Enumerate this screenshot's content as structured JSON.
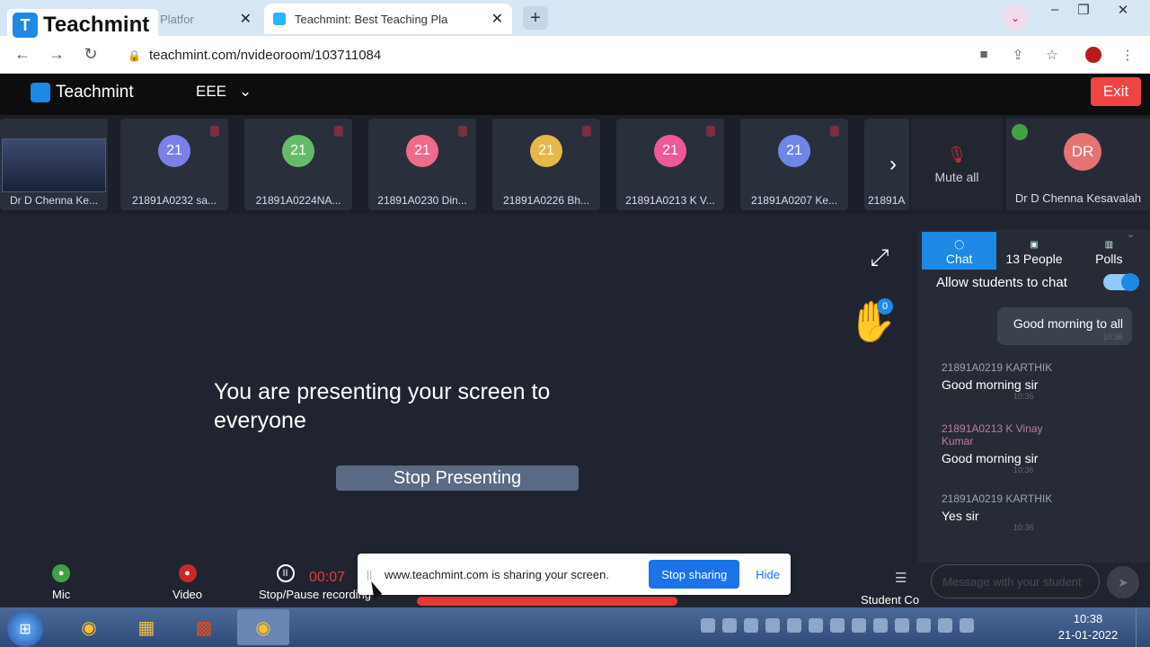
{
  "browser": {
    "inactive_tab_title": "ng Platfor",
    "active_tab_title": "Teachmint: Best Teaching Pla",
    "url": "teachmint.com/nvideoroom/103711084",
    "brand_overlay": "Teachmint"
  },
  "app": {
    "logo_text": "Teachmint",
    "class_name": "EEE",
    "exit_label": "Exit"
  },
  "participants": [
    {
      "initials": "21",
      "name": "21891A0232 sa...",
      "color": "#7b7fe8"
    },
    {
      "initials": "21",
      "name": "21891A0224NA...",
      "color": "#66bb6a"
    },
    {
      "initials": "21",
      "name": "21891A0230 Din...",
      "color": "#ef6b8a"
    },
    {
      "initials": "21",
      "name": "21891A0226 Bh...",
      "color": "#e6b84a"
    },
    {
      "initials": "21",
      "name": "21891A0213 K V...",
      "color": "#ec5b95"
    },
    {
      "initials": "21",
      "name": "21891A0207 Ke...",
      "color": "#6f86e6"
    }
  ],
  "screen_tile_name": "Dr D Chenna Ke...",
  "partial_tile_name": "21891A",
  "mute_all_label": "Mute all",
  "teacher": {
    "initials": "DR",
    "name": "Dr D Chenna Kesavalah"
  },
  "stage": {
    "present_text": "You are presenting your screen to everyone",
    "stop_presenting_label": "Stop Presenting",
    "hand_count": "0"
  },
  "chat": {
    "tabs": [
      {
        "label": "Chat"
      },
      {
        "label": "13 People"
      },
      {
        "label": "Polls"
      }
    ],
    "allow_label": "Allow students to chat",
    "outgoing": "Good morning to all",
    "outgoing_time": "10:36",
    "messages": [
      {
        "sender": "21891A0219 KARTHIK",
        "text": "Good morning sir",
        "time": "10:36"
      },
      {
        "sender": "21891A0213 K Vinay Kumar",
        "text": "Good morning sir",
        "time": "10:36"
      },
      {
        "sender": "21891A0219 KARTHIK",
        "text": "Yes sir",
        "time": "10:36"
      }
    ],
    "input_placeholder": "Message with your student"
  },
  "controls": {
    "mic": "Mic",
    "video": "Video",
    "recording": "Stop/Pause recording",
    "recording_time": "00:07",
    "student_controls": "Student Co"
  },
  "share_bar": {
    "message": "www.teachmint.com is sharing your screen.",
    "stop_label": "Stop sharing",
    "hide_label": "Hide"
  },
  "taskbar": {
    "time": "10:38",
    "date": "21-01-2022"
  }
}
